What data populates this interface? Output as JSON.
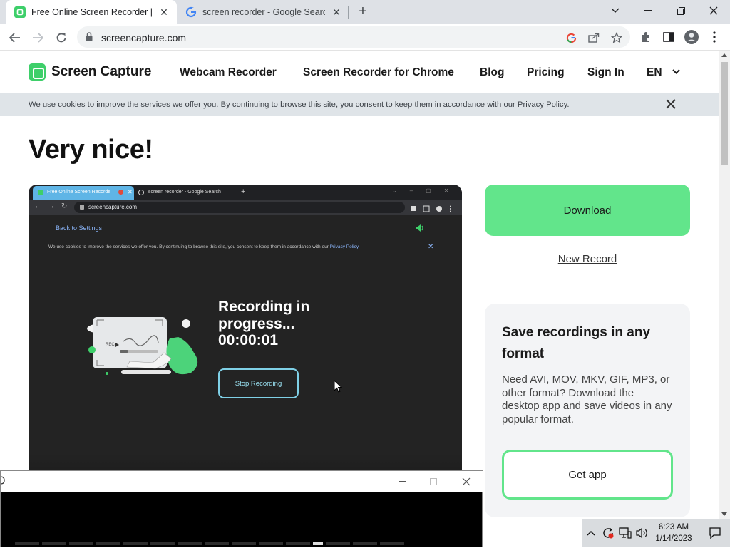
{
  "browser": {
    "tabs": [
      {
        "title": "Free Online Screen Recorder | Or",
        "active": true
      },
      {
        "title": "screen recorder - Google Search",
        "active": false
      }
    ],
    "new_tab_label": "+",
    "url": "screencapture.com"
  },
  "site": {
    "logo_text": "Screen Capture",
    "nav": [
      "Webcam Recorder",
      "Screen Recorder for Chrome",
      "Blog",
      "Pricing",
      "Sign In",
      "EN"
    ],
    "cookie_text": "We use cookies to improve the services we offer you. By continuing to browse this site, you consent to keep them in accordance with our",
    "cookie_link": "Privacy Policy",
    "cookie_period": ".",
    "heading": "Very nice!"
  },
  "preview": {
    "tab1": "Free Online Screen Recorde",
    "tab2": "screen recorder - Google Search",
    "url": "screencapture.com",
    "back_link": "Back to Settings",
    "cookie_text": "We use cookies to improve the services we offer you. By continuing to browse this site, you consent to keep them in accordance with our",
    "cookie_link": "Privacy Policy",
    "status_line1": "Recording in",
    "status_line2": "progress...",
    "timer": "00:00:01",
    "stop_label": "Stop Recording"
  },
  "actions": {
    "download_label": "Download",
    "new_record_label": "New Record"
  },
  "card": {
    "title": "Save recordings in any format",
    "body": "Need AVI, MOV, MKV, GIF, MP3, or other format? Download the desktop app and save videos in any popular format.",
    "button_label": "Get app"
  },
  "taskbar": {
    "time": "6:23 AM",
    "date": "1/14/2023"
  },
  "colors": {
    "accent_green": "#62e58b",
    "stop_border": "#7fd0e6",
    "tab_preview_blue": "#5fb5e6"
  }
}
